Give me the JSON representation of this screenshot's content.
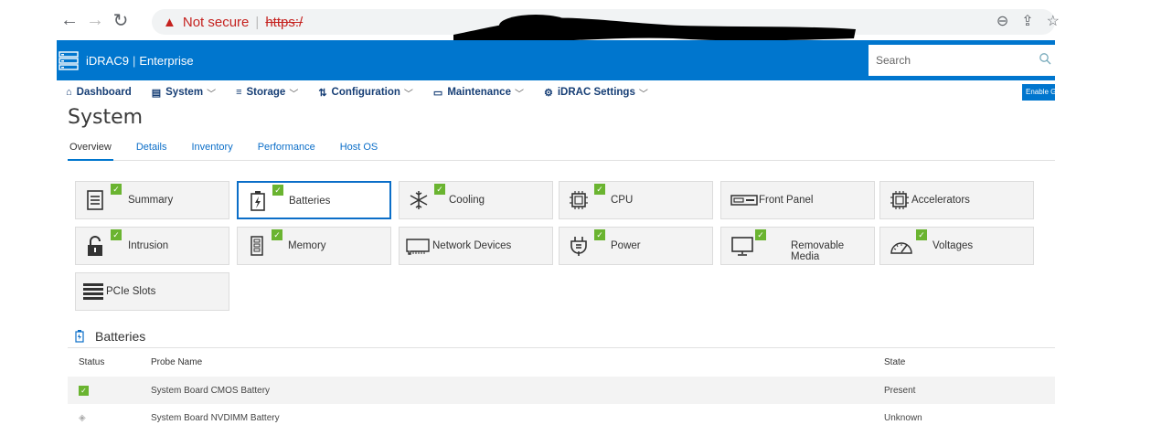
{
  "browser": {
    "not_secure": "Not secure",
    "separator": "|",
    "protocol": "https:/"
  },
  "header": {
    "product": "iDRAC9",
    "edition": "Enterprise",
    "search_placeholder": "Search",
    "color": "#0076ce"
  },
  "nav": {
    "items": [
      {
        "label": "Dashboard",
        "icon": "home-icon"
      },
      {
        "label": "System",
        "icon": "system-icon"
      },
      {
        "label": "Storage",
        "icon": "storage-icon"
      },
      {
        "label": "Configuration",
        "icon": "configuration-icon"
      },
      {
        "label": "Maintenance",
        "icon": "maintenance-icon"
      },
      {
        "label": "iDRAC Settings",
        "icon": "settings-icon"
      }
    ],
    "enable_label": "Enable G"
  },
  "page": {
    "title": "System",
    "tabs": [
      "Overview",
      "Details",
      "Inventory",
      "Performance",
      "Host OS"
    ],
    "active_tab": "Overview"
  },
  "tiles": [
    {
      "label": "Summary",
      "icon": "summary-icon",
      "ok": true
    },
    {
      "label": "Batteries",
      "icon": "battery-icon",
      "ok": true,
      "selected": true
    },
    {
      "label": "Cooling",
      "icon": "snowflake-icon",
      "ok": true
    },
    {
      "label": "CPU",
      "icon": "cpu-icon",
      "ok": true
    },
    {
      "label": "Front Panel",
      "icon": "front-panel-icon",
      "ok": false
    },
    {
      "label": "Accelerators",
      "icon": "accelerator-icon",
      "ok": false
    },
    {
      "label": "Intrusion",
      "icon": "lock-icon",
      "ok": true
    },
    {
      "label": "Memory",
      "icon": "memory-icon",
      "ok": true
    },
    {
      "label": "Network Devices",
      "icon": "network-card-icon",
      "ok": false
    },
    {
      "label": "Power",
      "icon": "plug-icon",
      "ok": true
    },
    {
      "label": "Removable Media",
      "icon": "monitor-icon",
      "ok": true
    },
    {
      "label": "Voltages",
      "icon": "gauge-icon",
      "ok": true
    },
    {
      "label": "PCIe Slots",
      "icon": "pcie-icon",
      "ok": false
    }
  ],
  "batteries": {
    "title": "Batteries",
    "columns": {
      "status": "Status",
      "name": "Probe Name",
      "state": "State"
    },
    "rows": [
      {
        "status": "ok",
        "name": "System Board CMOS Battery",
        "state": "Present"
      },
      {
        "status": "unknown",
        "name": "System Board NVDIMM Battery",
        "state": "Unknown"
      }
    ]
  },
  "colors": {
    "ok_green": "#6ab430",
    "link_blue": "#0b6ec8",
    "warning_red": "#c5221f"
  }
}
